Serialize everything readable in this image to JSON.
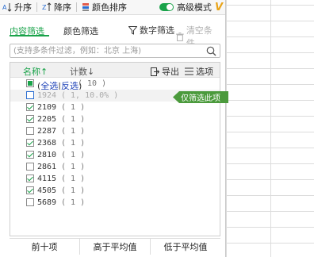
{
  "toolbar": {
    "sort_asc": "升序",
    "sort_desc": "降序",
    "color_sort": "颜色排序",
    "advanced_mode": "高级模式",
    "vip_mark": "V"
  },
  "tabs": {
    "content_filter": "内容筛选",
    "color_filter": "颜色筛选",
    "number_filter": "数字筛选",
    "clear_conditions": "清空条件"
  },
  "search": {
    "placeholder": "(支持多条件过滤，例如：北京 上海)"
  },
  "list_header": {
    "name": "名称↑",
    "count": "计数↓",
    "export": "导出",
    "options": "选项"
  },
  "select_all": {
    "all": "全选",
    "inverse": "反选",
    "open": "(",
    "sep": "|",
    "close": ")",
    "count": "( 10 )"
  },
  "items": [
    {
      "value": "1924",
      "count": "( 1, 10.0% )",
      "checked": false
    },
    {
      "value": "2109",
      "count": "( 1 )",
      "checked": true
    },
    {
      "value": "2205",
      "count": "( 1 )",
      "checked": true
    },
    {
      "value": "2287",
      "count": "( 1 )",
      "checked": false
    },
    {
      "value": "2368",
      "count": "( 1 )",
      "checked": true
    },
    {
      "value": "2810",
      "count": "( 1 )",
      "checked": true
    },
    {
      "value": "2861",
      "count": "( 1 )",
      "checked": false
    },
    {
      "value": "4115",
      "count": "( 1 )",
      "checked": true
    },
    {
      "value": "4505",
      "count": "( 1 )",
      "checked": true
    },
    {
      "value": "5689",
      "count": "( 1 )",
      "checked": false
    }
  ],
  "only_filter": "仅筛选此项",
  "footer": {
    "top_ten": "前十项",
    "above_avg": "高于平均值",
    "below_avg": "低于平均值"
  },
  "colors": {
    "accent": "#1aa34a",
    "badge": "#4b9a3c",
    "link": "#1a3fb7"
  }
}
